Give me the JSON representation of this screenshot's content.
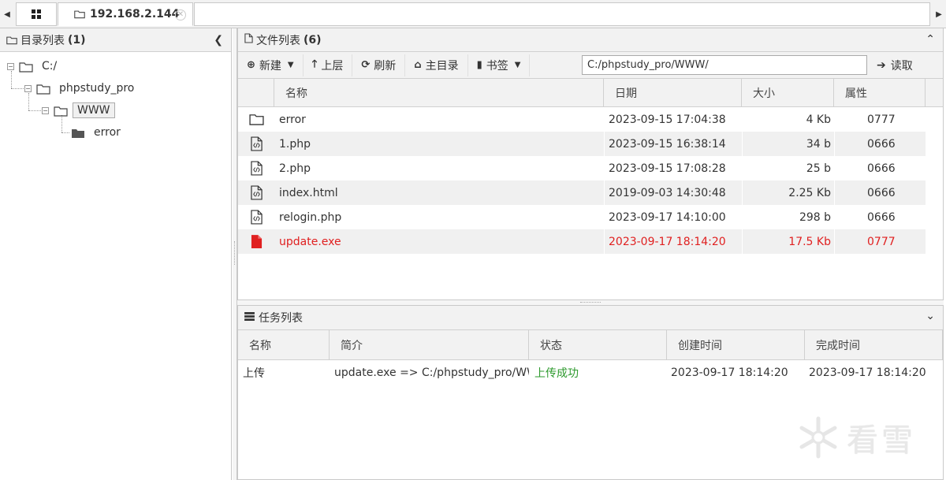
{
  "tabbar": {
    "host_tab": "192.168.2.144",
    "grid_icon": "grid-icon",
    "close_icon": "close-circle-icon"
  },
  "dir_panel": {
    "title": "目录列表",
    "count": "(1)",
    "tree": {
      "root": "C:/",
      "level1": "phpstudy_pro",
      "level2": "WWW",
      "level3": "error"
    }
  },
  "files_panel": {
    "title": "文件列表",
    "count": "(6)",
    "toolbar": {
      "new": "新建",
      "up": "上层",
      "refresh": "刷新",
      "home": "主目录",
      "bookmark": "书签",
      "path": "C:/phpstudy_pro/WWW/",
      "read": "读取"
    },
    "columns": {
      "name": "名称",
      "date": "日期",
      "size": "大小",
      "perm": "属性"
    },
    "rows": [
      {
        "icon": "folder-icon",
        "name": "error",
        "date": "2023-09-15 17:04:38",
        "size": "4 Kb",
        "perm": "0777"
      },
      {
        "icon": "code-file-icon",
        "name": "1.php",
        "date": "2023-09-15 16:38:14",
        "size": "34 b",
        "perm": "0666"
      },
      {
        "icon": "code-file-icon",
        "name": "2.php",
        "date": "2023-09-15 17:08:28",
        "size": "25 b",
        "perm": "0666"
      },
      {
        "icon": "code-file-icon",
        "name": "index.html",
        "date": "2019-09-03 14:30:48",
        "size": "2.25 Kb",
        "perm": "0666"
      },
      {
        "icon": "code-file-icon",
        "name": "relogin.php",
        "date": "2023-09-17 14:10:00",
        "size": "298 b",
        "perm": "0666"
      },
      {
        "icon": "file-red-icon",
        "name": "update.exe",
        "date": "2023-09-17 18:14:20",
        "size": "17.5 Kb",
        "perm": "0777"
      }
    ]
  },
  "tasks_panel": {
    "title": "任务列表",
    "columns": {
      "name": "名称",
      "desc": "简介",
      "status": "状态",
      "created": "创建时间",
      "finished": "完成时间"
    },
    "rows": [
      {
        "name": "上传",
        "desc": "update.exe => C:/phpstudy_pro/WWW/",
        "status": "上传成功",
        "created": "2023-09-17 18:14:20",
        "finished": "2023-09-17 18:14:20"
      }
    ]
  },
  "watermark": "看雪",
  "colors": {
    "accent_red": "#e02020",
    "success_green": "#2e9a2e",
    "header_bg": "#f2f2f2"
  }
}
